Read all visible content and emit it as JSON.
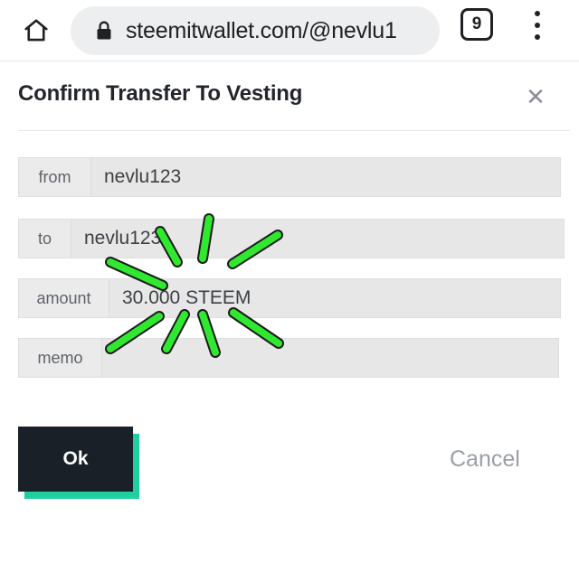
{
  "browser": {
    "home_icon": "home-icon",
    "lock_icon": "lock-icon",
    "url": "steemitwallet.com/@nevlu1",
    "tab_count": "9",
    "menu_icon": "overflow-menu-icon"
  },
  "dialog": {
    "title": "Confirm Transfer To Vesting",
    "close_icon": "close-icon",
    "close_label": "✕",
    "rows": [
      {
        "label": "from",
        "value": "nevlu123"
      },
      {
        "label": "to",
        "value": "nevlu123"
      },
      {
        "label": "amount",
        "value": "30.000 STEEM"
      },
      {
        "label": "memo",
        "value": ""
      }
    ],
    "ok_label": "Ok",
    "cancel_label": "Cancel"
  },
  "annotation": {
    "type": "starburst-highlight",
    "target": "amount-field",
    "stroke_color": "#2fe82f",
    "outline_color": "#1a1a1a",
    "stroke_count": 8
  },
  "colors": {
    "accent_teal": "#1fcfa0",
    "button_dark": "#1a2027",
    "field_gray": "#e7e7e8",
    "label_gray": "#ebebec",
    "omnibox_gray": "#eceef0",
    "muted_text": "#9aa0a6",
    "annotation_green": "#2fe82f"
  }
}
